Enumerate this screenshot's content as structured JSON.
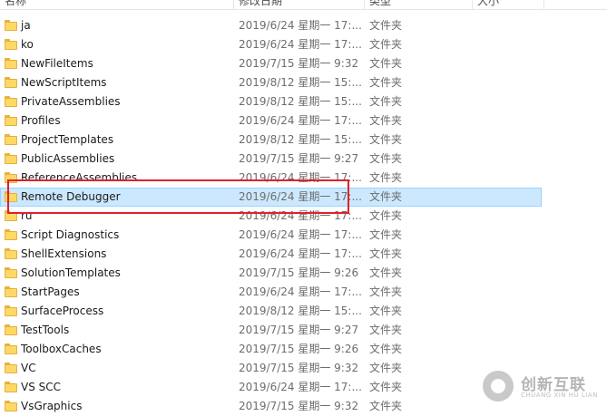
{
  "header": {
    "col_name": "名称",
    "col_date": "修改日期",
    "col_type": "类型",
    "col_size": "大小"
  },
  "rows": [
    {
      "name": "ja",
      "date": "2019/6/24 星期一 17:...",
      "type": "文件夹"
    },
    {
      "name": "ko",
      "date": "2019/6/24 星期一 17:...",
      "type": "文件夹"
    },
    {
      "name": "NewFileItems",
      "date": "2019/7/15 星期一 9:32",
      "type": "文件夹"
    },
    {
      "name": "NewScriptItems",
      "date": "2019/8/12 星期一 15:...",
      "type": "文件夹"
    },
    {
      "name": "PrivateAssemblies",
      "date": "2019/8/12 星期一 15:...",
      "type": "文件夹"
    },
    {
      "name": "Profiles",
      "date": "2019/6/24 星期一 17:...",
      "type": "文件夹"
    },
    {
      "name": "ProjectTemplates",
      "date": "2019/8/12 星期一 15:...",
      "type": "文件夹"
    },
    {
      "name": "PublicAssemblies",
      "date": "2019/7/15 星期一 9:27",
      "type": "文件夹"
    },
    {
      "name": "ReferenceAssemblies",
      "date": "2019/6/24 星期一 17:...",
      "type": "文件夹"
    },
    {
      "name": "Remote Debugger",
      "date": "2019/6/24 星期一 17:...",
      "type": "文件夹",
      "selected": true
    },
    {
      "name": "ru",
      "date": "2019/6/24 星期一 17:...",
      "type": "文件夹"
    },
    {
      "name": "Script Diagnostics",
      "date": "2019/6/24 星期一 17:...",
      "type": "文件夹"
    },
    {
      "name": "ShellExtensions",
      "date": "2019/6/24 星期一 17:...",
      "type": "文件夹"
    },
    {
      "name": "SolutionTemplates",
      "date": "2019/7/15 星期一 9:26",
      "type": "文件夹"
    },
    {
      "name": "StartPages",
      "date": "2019/6/24 星期一 17:...",
      "type": "文件夹"
    },
    {
      "name": "SurfaceProcess",
      "date": "2019/8/12 星期一 15:...",
      "type": "文件夹"
    },
    {
      "name": "TestTools",
      "date": "2019/7/15 星期一 9:27",
      "type": "文件夹"
    },
    {
      "name": "ToolboxCaches",
      "date": "2019/7/15 星期一 9:26",
      "type": "文件夹"
    },
    {
      "name": "VC",
      "date": "2019/7/15 星期一 9:32",
      "type": "文件夹"
    },
    {
      "name": "VS SCC",
      "date": "2019/6/24 星期一 17:...",
      "type": "文件夹"
    },
    {
      "name": "VsGraphics",
      "date": "2019/7/15 星期一 9:32",
      "type": "文件夹"
    }
  ],
  "icons": {
    "row_icon": "folder-icon"
  },
  "colors": {
    "selection": "#cce8ff",
    "highlight_box": "#e0212a",
    "folder": "#ffd866"
  },
  "watermark": {
    "cn": "创新互联",
    "en": "CHUANG XIN HU LIAN"
  }
}
